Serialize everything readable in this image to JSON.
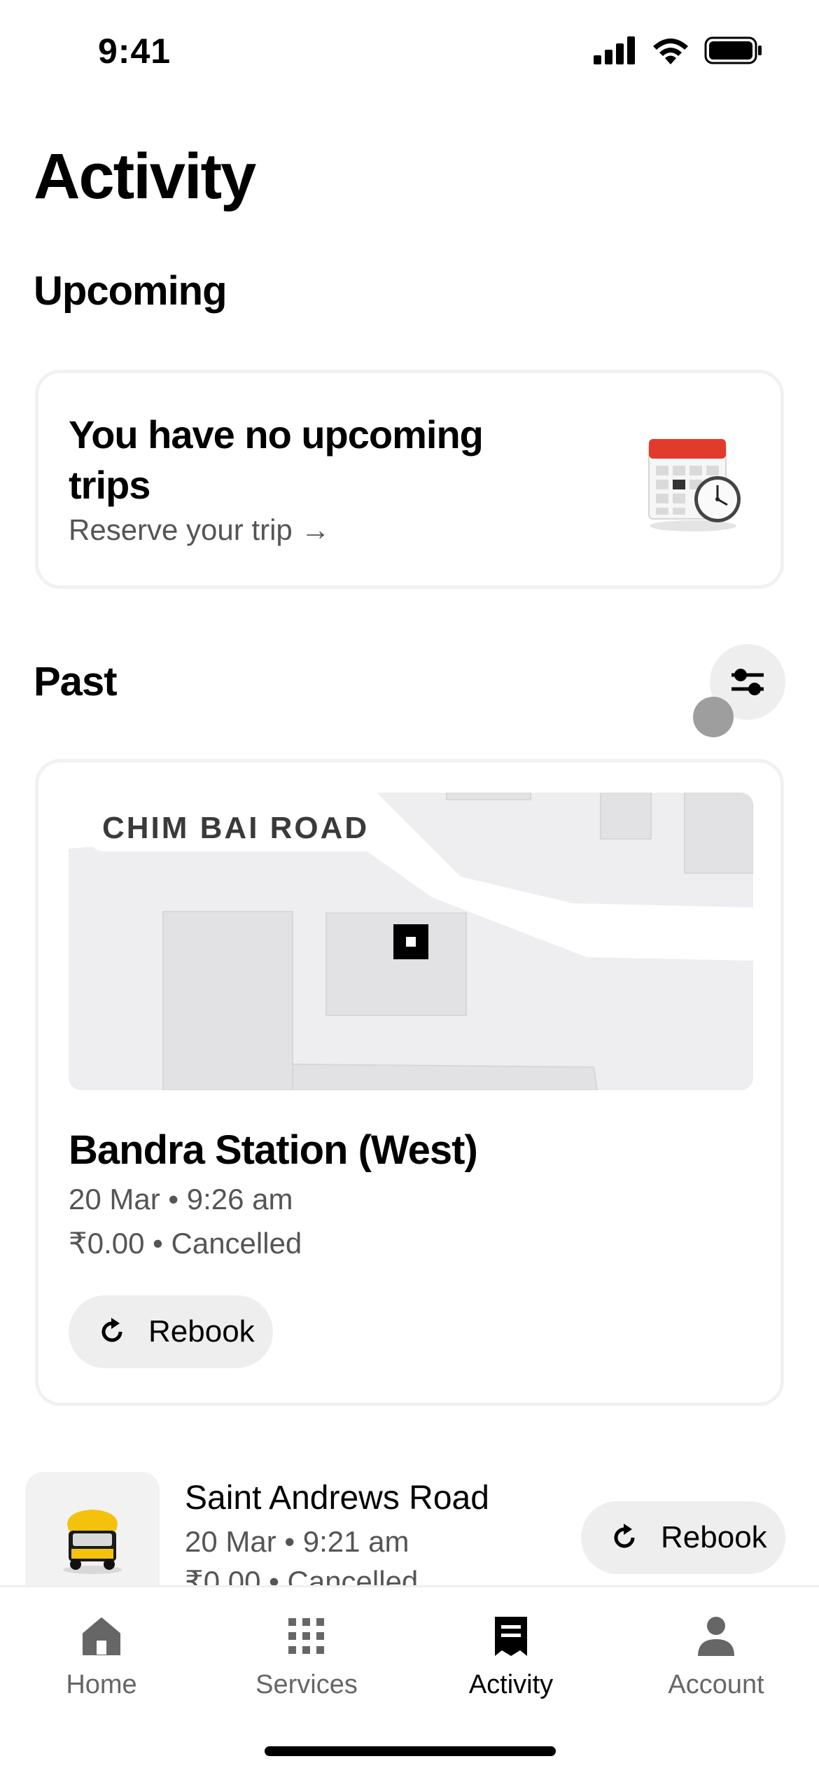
{
  "status_bar": {
    "time": "9:41"
  },
  "page": {
    "title": "Activity"
  },
  "upcoming": {
    "section_title": "Upcoming",
    "headline": "You have no upcoming trips",
    "reserve_label": "Reserve your trip",
    "reserve_arrow": "→"
  },
  "past": {
    "section_title": "Past",
    "trips": [
      {
        "map_street_label": "CHIM BAI ROAD",
        "title": "Bandra Station (West)",
        "date_time": "20 Mar • 9:26 am",
        "fare_status": "₹0.00 • Cancelled",
        "rebook_label": "Rebook"
      },
      {
        "title": "Saint Andrews Road",
        "date_time": "20 Mar • 9:21 am",
        "fare_status": "₹0.00 • Cancelled",
        "rebook_label": "Rebook"
      }
    ]
  },
  "tabs": [
    {
      "label": "Home",
      "icon": "home-icon",
      "active": false
    },
    {
      "label": "Services",
      "icon": "grid-icon",
      "active": false
    },
    {
      "label": "Activity",
      "icon": "receipt-icon",
      "active": true
    },
    {
      "label": "Account",
      "icon": "person-icon",
      "active": false
    }
  ],
  "colors": {
    "text_primary": "#000000",
    "text_secondary": "#555555",
    "tab_inactive": "#666666",
    "chip_background": "#eeeeee",
    "card_border": "#f1f1f1",
    "map_background": "#eeeef0"
  }
}
